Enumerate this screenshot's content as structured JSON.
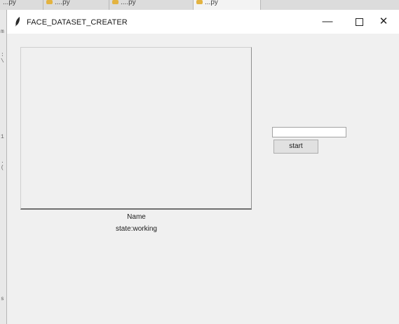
{
  "background_tabs": [
    "...py",
    "....py",
    "....py",
    "...py"
  ],
  "window": {
    "title": "FACE_DATASET_CREATER",
    "icon": "feather-icon"
  },
  "controls": {
    "minimize": "—",
    "close": "✕"
  },
  "labels": {
    "name": "Name",
    "state": "state:working"
  },
  "entry": {
    "value": ""
  },
  "buttons": {
    "start": "start"
  }
}
